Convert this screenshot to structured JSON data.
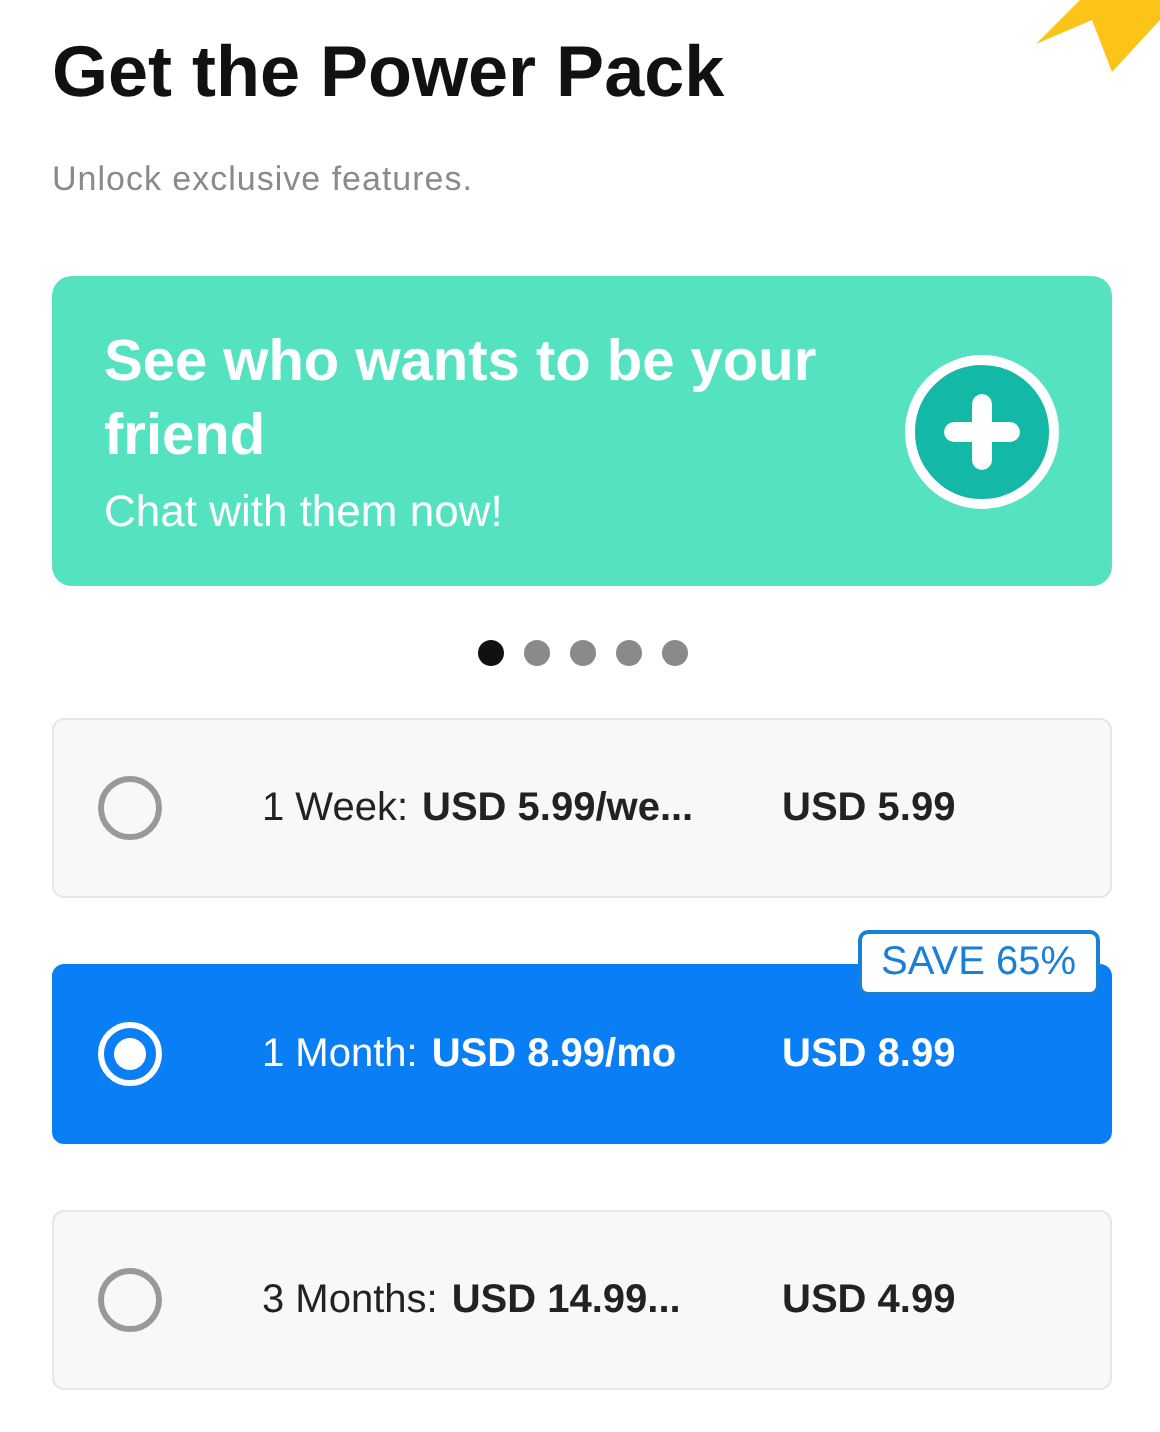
{
  "title": "Get the Power Pack",
  "subtitle": "Unlock exclusive features.",
  "banner": {
    "headline": "See who wants to be your friend",
    "subline": "Chat with them now!"
  },
  "pager": [
    {
      "selected": true
    },
    {
      "selected": false
    },
    {
      "selected": false
    },
    {
      "selected": false
    },
    {
      "selected": false
    }
  ],
  "plans": [
    {
      "label": "1 Week:",
      "rate": "USD 5.99/we...",
      "price": "USD 5.99",
      "selected": false
    },
    {
      "label": "1 Month:",
      "rate": "USD 8.99/mo",
      "price": "USD 8.99",
      "selected": true,
      "badge": "SAVE 65%"
    },
    {
      "label": "3 Months:",
      "rate": "USD 14.99...",
      "price": "USD 4.99",
      "selected": false
    }
  ]
}
